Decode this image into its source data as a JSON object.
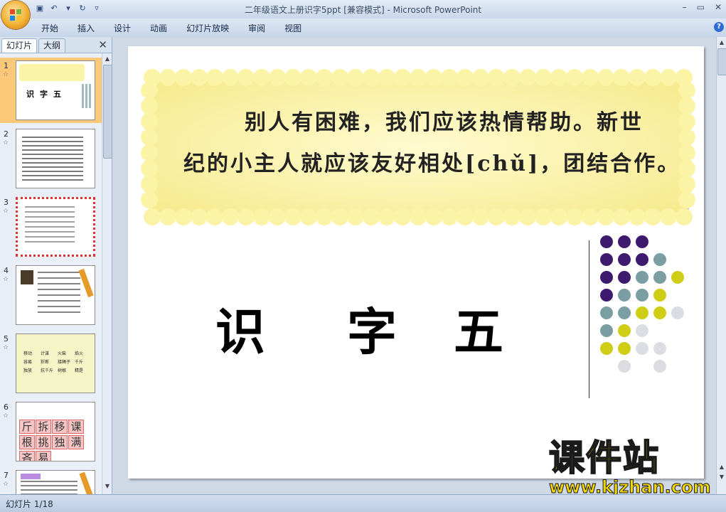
{
  "window": {
    "title": "二年级语文上册识字5ppt [兼容模式] - Microsoft PowerPoint",
    "controls": [
      "–",
      "▭",
      "✕"
    ]
  },
  "ribbon": {
    "tabs": [
      "开始",
      "插入",
      "设计",
      "动画",
      "幻灯片放映",
      "审阅",
      "视图"
    ],
    "help": "?"
  },
  "panel": {
    "tab_slides": "幻灯片",
    "tab_outline": "大纲",
    "close": "✕",
    "thumbnails": [
      {
        "num": "1",
        "selected": true
      },
      {
        "num": "2",
        "selected": false
      },
      {
        "num": "3",
        "selected": false
      },
      {
        "num": "4",
        "selected": false
      },
      {
        "num": "5",
        "selected": false
      },
      {
        "num": "6",
        "selected": false
      },
      {
        "num": "7",
        "selected": false
      }
    ],
    "thumb6_chars": [
      "斤",
      "拆",
      "移",
      "课",
      "根",
      "挑",
      "独",
      "满",
      "吝",
      "易"
    ],
    "thumb5_words": [
      "移动",
      "计谋",
      "火柴",
      "焰火",
      "容易",
      "折断",
      "接绳子",
      "千斤",
      "独放",
      "抗千斤",
      "树根",
      "精是"
    ]
  },
  "slide": {
    "banner_line1": "别人有困难，我们应该热情帮助。新世",
    "banner_line2": "纪的小主人就应该友好相处[chǔ]，团结合作。",
    "title_chars": [
      "识",
      "字",
      "五"
    ],
    "accent_colors": {
      "purple": "#3d1a6e",
      "teal": "#7a9ea2",
      "lime": "#cfcd16",
      "grey": "#dcdde3",
      "banner": "#fbf3a6"
    }
  },
  "status": {
    "slide_counter": "幻灯片 1/18"
  },
  "watermark": {
    "cn": "课件站",
    "url": "www.kjzhan.com"
  }
}
